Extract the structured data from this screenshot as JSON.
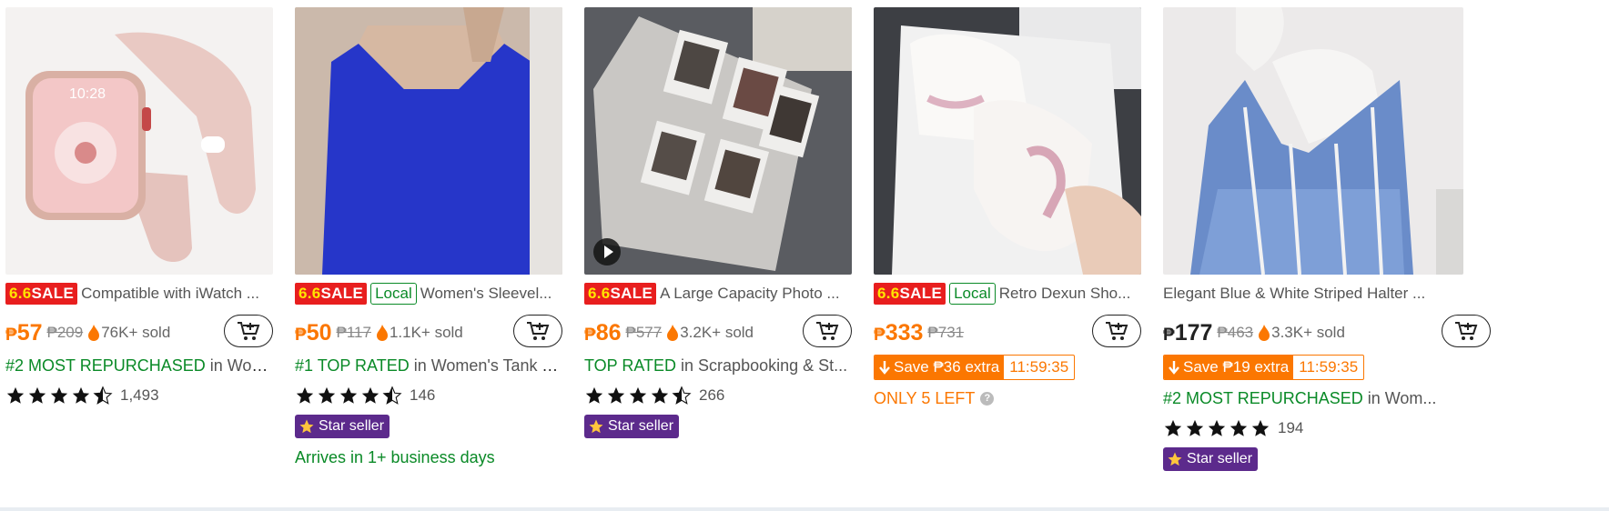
{
  "products": [
    {
      "image": "pink-apple-watch-band-image",
      "sale_badge": "6.6SALE",
      "sale_prefix": "6.6",
      "sale_word": "SALE",
      "local": null,
      "title": "Compatible with iWatch ...",
      "price_currency": "₱",
      "price": "57",
      "original_price": "₱209",
      "sold": "76K+ sold",
      "rank_highlight": "#2 MOST REPURCHASED",
      "rank_rest": " in Wom...",
      "rating_stars": 4.5,
      "rating_count": "1,493"
    },
    {
      "image": "blue-tank-top-image",
      "sale_prefix": "6.6",
      "sale_word": "SALE",
      "local": "Local",
      "title": "Women's Sleevel...",
      "price_currency": "₱",
      "price": "50",
      "original_price": "₱117",
      "sold": "1.1K+ sold",
      "rank_highlight": "#1 TOP RATED",
      "rank_rest": " in Women's Tank T...",
      "rating_stars": 4.5,
      "rating_count": "146",
      "star_seller": "Star seller",
      "arrives": "Arrives in 1+ business days"
    },
    {
      "image": "photo-album-image",
      "sale_prefix": "6.6",
      "sale_word": "SALE",
      "local": null,
      "title": "A Large Capacity Photo ...",
      "price_currency": "₱",
      "price": "86",
      "original_price": "₱577",
      "sold": "3.2K+ sold",
      "rank_highlight": "TOP RATED",
      "rank_rest": " in Scrapbooking & St...",
      "rating_stars": 4.5,
      "rating_count": "266",
      "star_seller": "Star seller"
    },
    {
      "image": "pink-white-sneakers-image",
      "sale_prefix": "6.6",
      "sale_word": "SALE",
      "local": "Local",
      "title": "Retro Dexun Sho...",
      "price_currency": "₱",
      "price": "333",
      "original_price": "₱731",
      "save_text": "Save ₱36 extra",
      "timer": "11:59:35",
      "stock_text": "ONLY 5 LEFT"
    },
    {
      "image": "striped-halter-top-image",
      "title": "Elegant Blue & White Striped Halter ...",
      "price_currency": "₱",
      "price": "177",
      "original_price": "₱463",
      "sold": "3.3K+ sold",
      "save_text": "Save ₱19 extra",
      "timer": "11:59:35",
      "rank_highlight": "#2 MOST REPURCHASED",
      "rank_rest": " in Wom...",
      "rating_stars": 5,
      "rating_count": "194",
      "star_seller": "Star seller"
    }
  ],
  "colors": {
    "accent_orange": "#fb7701",
    "sale_red": "#e81e1e",
    "green": "#0a8a27",
    "star_seller_purple": "#5c2a8c"
  },
  "icons": [
    "cart-add-icon",
    "flame-icon",
    "star-icon",
    "play-icon",
    "question-icon",
    "down-arrow-icon"
  ]
}
